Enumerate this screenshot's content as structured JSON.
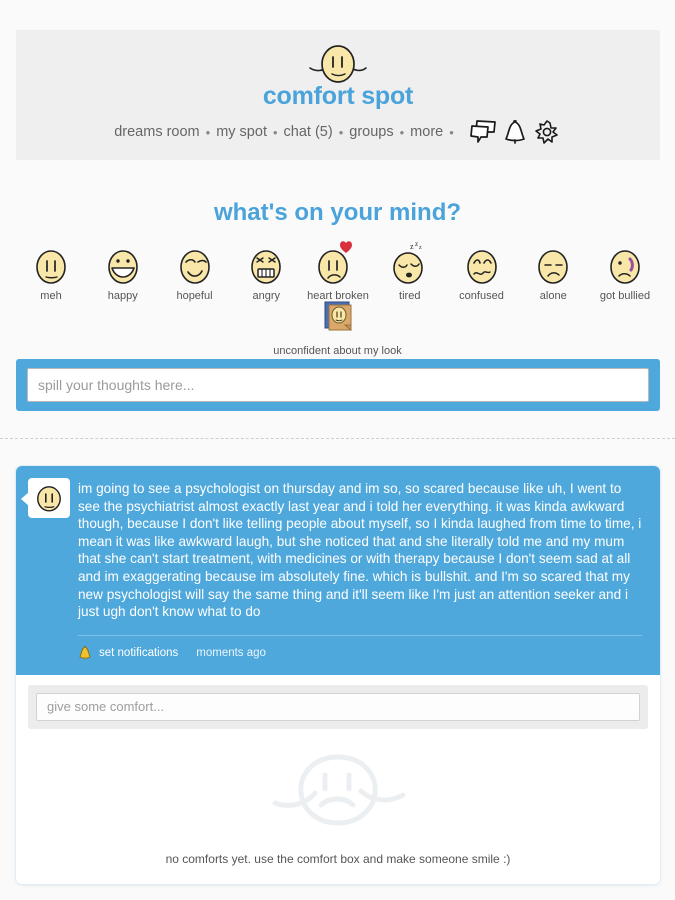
{
  "header": {
    "title": "comfort spot",
    "logo_icon": "meh-face-logo",
    "nav": [
      {
        "label": "dreams room",
        "name": "nav-dreams-room"
      },
      {
        "label": "my spot",
        "name": "nav-my-spot"
      },
      {
        "label": "chat (5)",
        "name": "nav-chat"
      },
      {
        "label": "groups",
        "name": "nav-groups"
      },
      {
        "label": "more",
        "name": "nav-more"
      }
    ],
    "separator": "•",
    "icons": [
      {
        "name": "messages-icon",
        "label": "messages"
      },
      {
        "name": "notifications-bell-icon",
        "label": "notifications"
      },
      {
        "name": "settings-gear-icon",
        "label": "settings"
      }
    ]
  },
  "mind": {
    "title": "what's on your mind?",
    "moods": [
      {
        "label": "meh",
        "icon": "meh-face-icon"
      },
      {
        "label": "happy",
        "icon": "happy-face-icon"
      },
      {
        "label": "hopeful",
        "icon": "hopeful-face-icon"
      },
      {
        "label": "angry",
        "icon": "angry-face-icon"
      },
      {
        "label": "heart broken",
        "icon": "heart-broken-face-icon"
      },
      {
        "label": "tired",
        "icon": "tired-face-icon"
      },
      {
        "label": "confused",
        "icon": "confused-face-icon"
      },
      {
        "label": "alone",
        "icon": "alone-face-icon"
      },
      {
        "label": "got bullied",
        "icon": "got-bullied-face-icon"
      }
    ],
    "extra_mood": {
      "label": "unconfident about my look",
      "icon": "mirror-photo-icon"
    }
  },
  "compose": {
    "placeholder": "spill your thoughts here..."
  },
  "post": {
    "avatar_icon": "meh-face-avatar",
    "text": "im going to see a psychologist on thursday and im so, so scared because like uh, I went to see the psychiatrist almost exactly last year and i told her everything. it was kinda awkward though, because I don't like telling people about myself, so I kinda laughed from time to time, i mean it was like awkward laugh, but she noticed that and she literally told me and my mum that she can't start treatment, with medicines or with therapy because I don't seem sad at all and im exaggerating because im absolutely fine. which is bullshit. and I'm so scared that my new psychologist will say the same thing and it'll seem like I'm just an attention seeker and i just ugh don't know what to do",
    "notifications_label": "set notifications",
    "notifications_icon": "bell-icon",
    "timestamp": "moments ago"
  },
  "comment": {
    "placeholder": "give some comfort..."
  },
  "empty": {
    "icon": "sad-face-drawing",
    "text": "no comforts yet. use the comfort box and make someone smile :)"
  },
  "colors": {
    "accent_blue": "#4fa8dc",
    "title_blue": "#4aa3da",
    "header_gray": "#efefef",
    "page_bg": "#fafafa",
    "face_yellow": "#f8e7a8",
    "heart_red": "#d8313b"
  }
}
